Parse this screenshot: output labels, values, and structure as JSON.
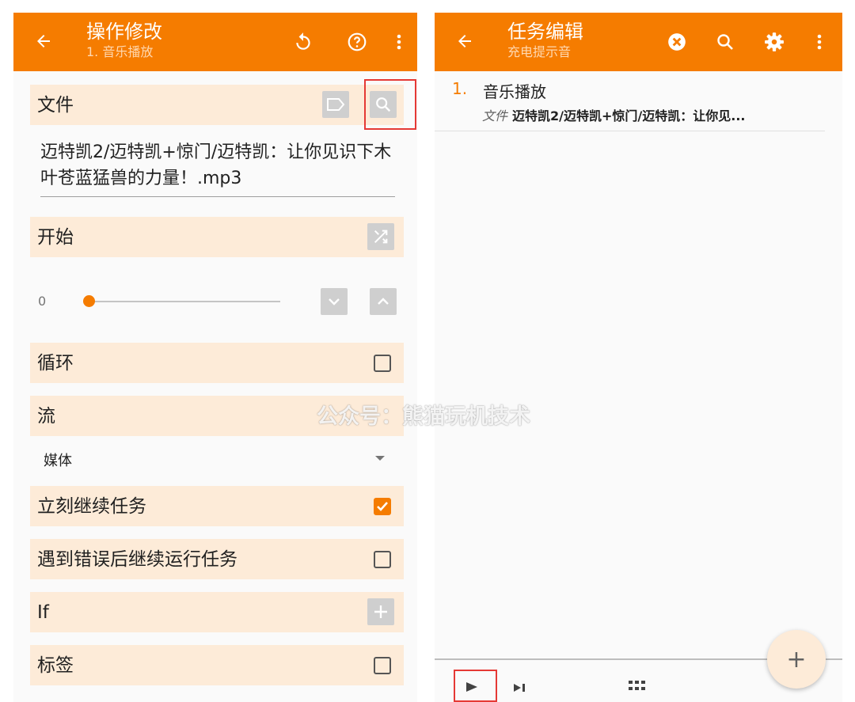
{
  "colors": {
    "accent": "#f57c00",
    "section_bg": "#fdebd8",
    "highlight_box": "#e53935"
  },
  "left": {
    "appbar": {
      "title": "操作修改",
      "subtitle": "1. 音乐播放",
      "icons": [
        "back-arrow-icon",
        "reset-icon",
        "help-icon",
        "more-icon"
      ]
    },
    "sections": {
      "file": {
        "label": "文件",
        "icons": [
          "tag-icon",
          "search-icon"
        ]
      },
      "file_value": "迈特凯2/迈特凯+惊门/迈特凯：让你见识下木叶苍蓝猛兽的力量！.mp3",
      "start": {
        "label": "开始",
        "icon": "shuffle-icon"
      },
      "slider": {
        "value": "0",
        "icons": [
          "chevron-down-icon",
          "chevron-up-icon"
        ]
      },
      "loop": {
        "label": "循环",
        "checked": false
      },
      "stream": {
        "label": "流"
      },
      "stream_value": "媒体",
      "continue_task": {
        "label": "立刻继续任务",
        "checked": true
      },
      "continue_on_error": {
        "label": "遇到错误后继续运行任务",
        "checked": false
      },
      "if": {
        "label": "If",
        "icon": "plus-icon"
      },
      "tag": {
        "label": "标签",
        "checked": false
      }
    }
  },
  "right": {
    "appbar": {
      "title": "任务编辑",
      "subtitle": "充电提示音",
      "icons": [
        "back-arrow-icon",
        "cancel-icon",
        "search-icon",
        "settings-icon",
        "more-icon"
      ]
    },
    "task": {
      "number": "1.",
      "name": "音乐播放",
      "detail_key": "文件",
      "detail_value": "迈特凯2/迈特凯+惊门/迈特凯：让你见..."
    },
    "bottom": {
      "icons": [
        "play-icon",
        "step-icon",
        "grid-icon"
      ]
    },
    "fab_label": "+"
  },
  "watermark": "公众号：熊猫玩机技术"
}
